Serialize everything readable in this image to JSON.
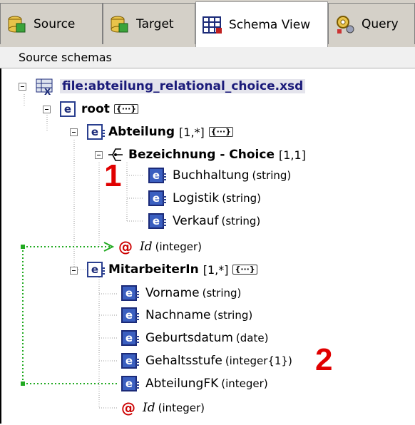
{
  "tabs": [
    {
      "label": "Source",
      "icon": "db-source-icon",
      "active": false
    },
    {
      "label": "Target",
      "icon": "db-target-icon",
      "active": false
    },
    {
      "label": "Schema View",
      "icon": "schema-grid-icon",
      "active": true
    },
    {
      "label": "Query",
      "icon": "query-icon",
      "active": false
    }
  ],
  "section_label": "Source schemas",
  "tree": {
    "file": "file:abteilung_relational_choice.xsd",
    "root": {
      "name": "root",
      "dots": "{···}"
    },
    "abteilung": {
      "name": "Abteilung",
      "occ": "[1,*]",
      "dots": "{···}"
    },
    "choice": {
      "name": "Bezeichnung - Choice",
      "occ": "[1,1]"
    },
    "choice_items": [
      {
        "name": "Buchhaltung",
        "type": "(string)"
      },
      {
        "name": "Logistik",
        "type": "(string)"
      },
      {
        "name": "Verkauf",
        "type": "(string)"
      }
    ],
    "abteilung_id": {
      "symbol": "@",
      "name": "Id",
      "type": "(integer)"
    },
    "mitarbeiter": {
      "name": "MitarbeiterIn",
      "occ": "[1,*]",
      "dots": "{···}"
    },
    "mitarbeiter_items": [
      {
        "name": "Vorname",
        "type": "(string)"
      },
      {
        "name": "Nachname",
        "type": "(string)"
      },
      {
        "name": "Geburtsdatum",
        "type": "(date)"
      },
      {
        "name": "Gehaltsstufe",
        "type": "(integer{1})"
      },
      {
        "name": "AbteilungFK",
        "type": "(integer)"
      }
    ],
    "mitarbeiter_id": {
      "symbol": "@",
      "name": "Id",
      "type": "(integer)"
    }
  },
  "callouts": [
    "1",
    "2"
  ],
  "colors": {
    "callout": "#e00000",
    "relation_line": "#22aa22",
    "accent": "#2a3f8f"
  }
}
